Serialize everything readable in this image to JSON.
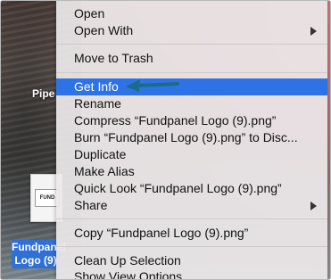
{
  "desktop": {
    "partial_label": "Pipe",
    "file_selection_label": "Fundpanel Logo (9)",
    "file_icon_text": "FUND"
  },
  "menu": {
    "items": [
      {
        "label": "Open",
        "submenu": false
      },
      {
        "label": "Open With",
        "submenu": true
      },
      {
        "label": "Move to Trash",
        "submenu": false
      },
      {
        "label": "Get Info",
        "submenu": false,
        "highlighted": true
      },
      {
        "label": "Rename",
        "submenu": false
      },
      {
        "label": "Compress “Fundpanel Logo (9).png”",
        "submenu": false
      },
      {
        "label": "Burn “Fundpanel Logo (9).png” to Disc...",
        "submenu": false
      },
      {
        "label": "Duplicate",
        "submenu": false
      },
      {
        "label": "Make Alias",
        "submenu": false
      },
      {
        "label": "Quick Look “Fundpanel Logo (9).png”",
        "submenu": false
      },
      {
        "label": "Share",
        "submenu": true
      },
      {
        "label": "Copy “Fundpanel Logo (9).png”",
        "submenu": false
      },
      {
        "label": "Clean Up Selection",
        "submenu": false
      },
      {
        "label": "Show View Options",
        "submenu": false
      }
    ]
  },
  "colors": {
    "highlight": "#2e73e5",
    "annotation_arrow": "#1d6b8a"
  }
}
